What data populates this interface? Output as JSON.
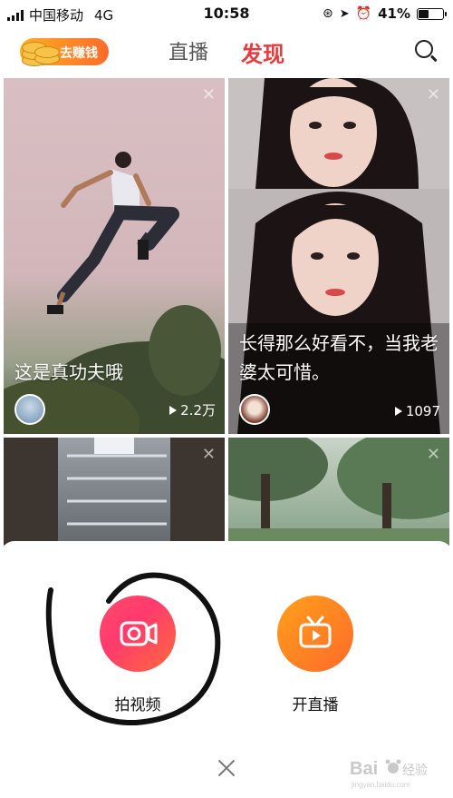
{
  "status_bar": {
    "carrier": "中国移动",
    "network": "4G",
    "time": "10:58",
    "battery": "41%"
  },
  "header": {
    "earn_label": "去赚钱",
    "tabs": [
      {
        "label": "直播",
        "active": false
      },
      {
        "label": "发现",
        "active": true
      }
    ]
  },
  "feed": {
    "cards": [
      {
        "title": "这是真功夫哦",
        "views": "2.2万"
      },
      {
        "title": "长得那么好看不，当我老婆太可惜。",
        "views": "1097"
      }
    ]
  },
  "sheet": {
    "actions": [
      {
        "label": "拍视频",
        "icon": "video-camera-icon"
      },
      {
        "label": "开直播",
        "icon": "live-tv-icon"
      }
    ]
  },
  "colors": {
    "accent": "#e83b3b",
    "shoot_gradient": [
      "#ff3d6e",
      "#ff7a3d"
    ],
    "live_gradient": [
      "#ff8a1f",
      "#ff5a2a"
    ]
  }
}
